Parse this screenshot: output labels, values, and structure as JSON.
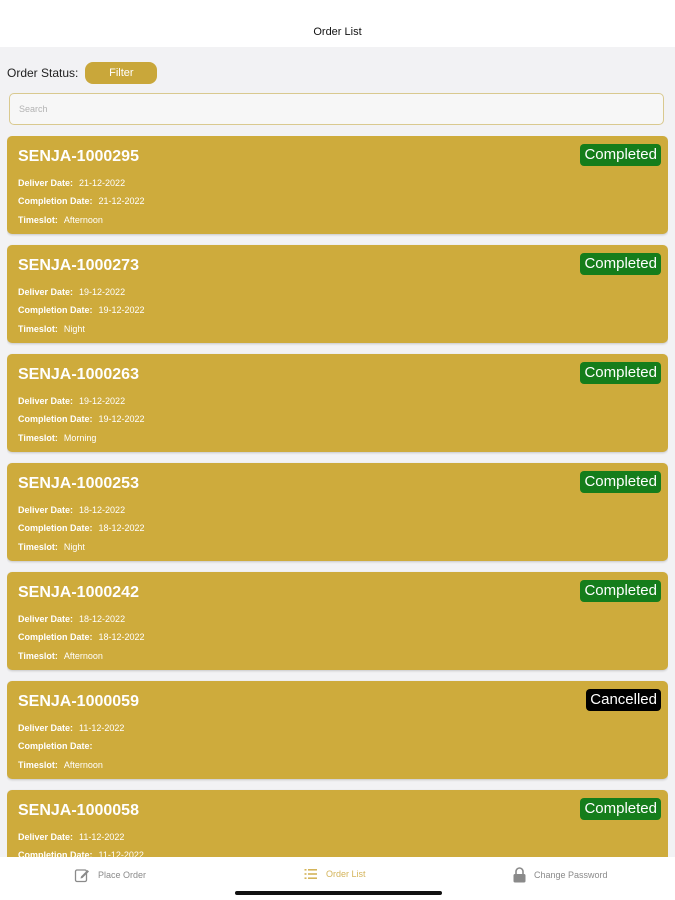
{
  "header": {
    "title": "Order List"
  },
  "filter": {
    "label": "Order Status:",
    "button_label": "Filter"
  },
  "search": {
    "placeholder": "Search",
    "value": ""
  },
  "field_labels": {
    "deliver": "Deliver Date:",
    "completion": "Completion Date:",
    "timeslot": "Timeslot:"
  },
  "orders": [
    {
      "id": "SENJA-1000295",
      "status": "Completed",
      "deliver_date": "21-12-2022",
      "completion_date": "21-12-2022",
      "timeslot": "Afternoon"
    },
    {
      "id": "SENJA-1000273",
      "status": "Completed",
      "deliver_date": "19-12-2022",
      "completion_date": "19-12-2022",
      "timeslot": "Night"
    },
    {
      "id": "SENJA-1000263",
      "status": "Completed",
      "deliver_date": "19-12-2022",
      "completion_date": "19-12-2022",
      "timeslot": "Morning"
    },
    {
      "id": "SENJA-1000253",
      "status": "Completed",
      "deliver_date": "18-12-2022",
      "completion_date": "18-12-2022",
      "timeslot": "Night"
    },
    {
      "id": "SENJA-1000242",
      "status": "Completed",
      "deliver_date": "18-12-2022",
      "completion_date": "18-12-2022",
      "timeslot": "Afternoon"
    },
    {
      "id": "SENJA-1000059",
      "status": "Cancelled",
      "deliver_date": "11-12-2022",
      "completion_date": "",
      "timeslot": "Afternoon"
    },
    {
      "id": "SENJA-1000058",
      "status": "Completed",
      "deliver_date": "11-12-2022",
      "completion_date": "11-12-2022",
      "timeslot": ""
    }
  ],
  "tabs": [
    {
      "label": "Place Order",
      "icon": "edit-icon",
      "active": false
    },
    {
      "label": "Order List",
      "icon": "list-icon",
      "active": true
    },
    {
      "label": "Change Password",
      "icon": "lock-icon",
      "active": false
    }
  ],
  "colors": {
    "accent": "#ceab3c",
    "completed": "#157d1b",
    "cancelled": "#000000"
  }
}
